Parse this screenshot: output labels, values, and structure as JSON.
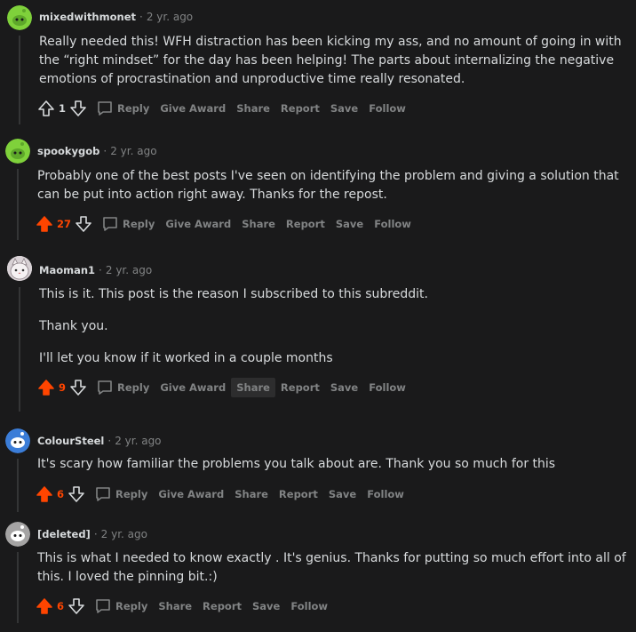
{
  "colors": {
    "background": "#1a1a1b",
    "text": "#d7dadc",
    "muted": "#818384",
    "upvote": "#ff4500",
    "thread_line": "#343536"
  },
  "comments": [
    {
      "username": "mixedwithmonet",
      "time": "2 yr. ago",
      "paragraphs": [
        "Really needed this! WFH distraction has been kicking my ass, and no amount of going in with the “right mindset” for the day has been helping! The parts about internalizing the negative emotions of procrastination and unproductive time really resonated."
      ],
      "score": "1",
      "upvoted": false,
      "actions": [
        "Reply",
        "Give Award",
        "Share",
        "Report",
        "Save",
        "Follow"
      ],
      "avatar_icon": "snoo-green-avatar"
    },
    {
      "username": "spookygob",
      "time": "2 yr. ago",
      "paragraphs": [
        "Probably one of the best posts I've seen on identifying the problem and giving a solution that can be put into action right away. Thanks for the repost."
      ],
      "score": "27",
      "upvoted": true,
      "actions": [
        "Reply",
        "Give Award",
        "Share",
        "Report",
        "Save",
        "Follow"
      ],
      "avatar_icon": "snoo-green-avatar"
    },
    {
      "username": "Maoman1",
      "time": "2 yr. ago",
      "paragraphs": [
        "This is it. This post is the reason I subscribed to this subreddit.",
        "Thank you.",
        "I'll let you know if it worked in a couple months"
      ],
      "score": "9",
      "upvoted": true,
      "actions": [
        "Reply",
        "Give Award",
        "Share",
        "Report",
        "Save",
        "Follow"
      ],
      "avatar_icon": "cat-avatar"
    },
    {
      "username": "ColourSteel",
      "time": "2 yr. ago",
      "paragraphs": [
        "It's scary how familiar the problems you talk about are. Thank you so much for this"
      ],
      "score": "6",
      "upvoted": true,
      "actions": [
        "Reply",
        "Give Award",
        "Share",
        "Report",
        "Save",
        "Follow"
      ],
      "avatar_icon": "snoo-blue-avatar"
    },
    {
      "username": "[deleted]",
      "time": "2 yr. ago",
      "paragraphs": [
        "This is what I needed to know exactly . It's genius. Thanks for putting so much effort into all of this. I loved the pinning bit.:)"
      ],
      "score": "6",
      "upvoted": true,
      "actions": [
        "Reply",
        "Share",
        "Report",
        "Save",
        "Follow"
      ],
      "avatar_icon": "snoo-gray-avatar"
    }
  ]
}
